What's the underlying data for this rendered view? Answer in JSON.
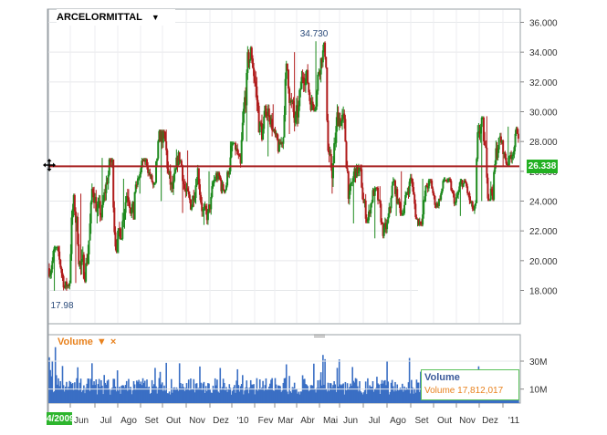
{
  "ticker": {
    "label": "ARCELORMITTAL",
    "dropdown_icon": "triangle-down-icon"
  },
  "volume_panel": {
    "label": "Volume",
    "dropdown_icon": "triangle-down-icon",
    "close_icon": "close-x-icon"
  },
  "tooltip": {
    "title": "Volume",
    "text": "Volume  17,812,017"
  },
  "start_date_label": "4/2009",
  "current_price_label": "26.338",
  "high_annotation": "34.730",
  "low_annotation": "17.98",
  "colors": {
    "up": "#1e8a1e",
    "down": "#b01c1c",
    "reference_line": "#a82020",
    "volume": "#3a6fc4",
    "badge": "#22b022",
    "accent": "#e8821e"
  },
  "chart_data": [
    {
      "type": "candlestick",
      "title": "ARCELORMITTAL",
      "x_tick_labels": [
        "Jun",
        "Jul",
        "Ago",
        "Set",
        "Out",
        "Nov",
        "Dez",
        "'10",
        "Fev",
        "Mar",
        "Abr",
        "Mai",
        "Jun",
        "Jul",
        "Ago",
        "Set",
        "Out",
        "Nov",
        "Dez",
        "'11"
      ],
      "y_tick_labels": [
        "36.000",
        "34.000",
        "32.000",
        "30.000",
        "28.000",
        "26.000",
        "24.000",
        "22.000",
        "20.000",
        "18.000"
      ],
      "ylim": [
        16.6,
        36.6
      ],
      "grid": true,
      "reference_line_value": 26.338,
      "annotations": [
        {
          "text": "34.730",
          "value": 34.73
        },
        {
          "text": "17.98",
          "value": 17.98
        }
      ],
      "monthly_range": [
        {
          "period": "Apr-2009",
          "low": 17.98,
          "high": 21.0
        },
        {
          "period": "May-2009",
          "low": 18.5,
          "high": 24.5
        },
        {
          "period": "Jun-2009",
          "low": 22.5,
          "high": 26.9
        },
        {
          "period": "Jul-2009",
          "low": 20.5,
          "high": 25.5
        },
        {
          "period": "Aug-2009",
          "low": 24.5,
          "high": 26.9
        },
        {
          "period": "Sep-2009",
          "low": 24.0,
          "high": 28.8
        },
        {
          "period": "Oct-2009",
          "low": 23.2,
          "high": 27.4
        },
        {
          "period": "Nov-2009",
          "low": 22.4,
          "high": 26.0
        },
        {
          "period": "Dec-2009",
          "low": 24.5,
          "high": 28.0
        },
        {
          "period": "Jan-2010",
          "low": 28.0,
          "high": 34.4
        },
        {
          "period": "Feb-2010",
          "low": 27.0,
          "high": 30.5
        },
        {
          "period": "Mar-2010",
          "low": 28.5,
          "high": 34.0
        },
        {
          "period": "Apr-2010",
          "low": 30.0,
          "high": 34.73
        },
        {
          "period": "May-2010",
          "low": 24.5,
          "high": 30.5
        },
        {
          "period": "Jun-2010",
          "low": 22.5,
          "high": 26.5
        },
        {
          "period": "Jul-2010",
          "low": 21.5,
          "high": 25.0
        },
        {
          "period": "Aug-2010",
          "low": 23.0,
          "high": 26.0
        },
        {
          "period": "Sep-2010",
          "low": 22.3,
          "high": 25.5
        },
        {
          "period": "Oct-2010",
          "low": 23.5,
          "high": 25.6
        },
        {
          "period": "Nov-2010",
          "low": 23.0,
          "high": 25.5
        },
        {
          "period": "Dec-2010",
          "low": 24.0,
          "high": 29.7
        },
        {
          "period": "Jan-2011",
          "low": 26.3,
          "high": 29.0
        }
      ]
    },
    {
      "type": "bar",
      "title": "Volume",
      "y_tick_labels": [
        "30M",
        "10M"
      ],
      "ylim": [
        0,
        42
      ],
      "series": [
        {
          "name": "Volume"
        }
      ],
      "last_value": 17812017
    }
  ]
}
